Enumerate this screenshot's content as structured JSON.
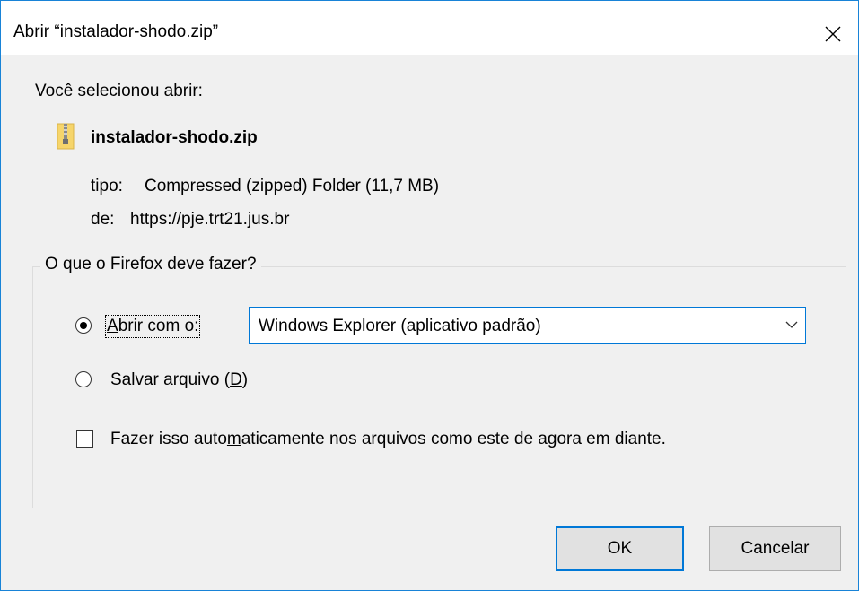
{
  "dialog": {
    "title": "Abrir “instalador-shodo.zip”",
    "intro": "Você selecionou abrir:",
    "file": {
      "icon": "zip-folder-icon",
      "name": "instalador-shodo.zip",
      "type_label": "tipo:",
      "type_value": "Compressed (zipped) Folder (11,7 MB)",
      "from_label": "de:",
      "from_value": "https://pje.trt21.jus.br"
    },
    "action_group": {
      "legend": "O que o Firefox deve fazer?",
      "open_with": {
        "label_access_key": "A",
        "label_rest": "brir com o:",
        "selected": true,
        "app": "Windows Explorer (aplicativo padrão)"
      },
      "save_file": {
        "label_prefix": "Salvar arquivo (",
        "access_key": "D",
        "label_suffix": ")",
        "selected": false
      },
      "auto": {
        "label_prefix": "Fazer isso auto",
        "access_key": "m",
        "label_suffix": "aticamente nos arquivos como este de agora em diante.",
        "checked": false
      }
    },
    "buttons": {
      "ok": "OK",
      "cancel": "Cancelar"
    },
    "colors": {
      "accent": "#0078d7",
      "window_border": "#1883d7",
      "background": "#f0f0f0"
    }
  }
}
